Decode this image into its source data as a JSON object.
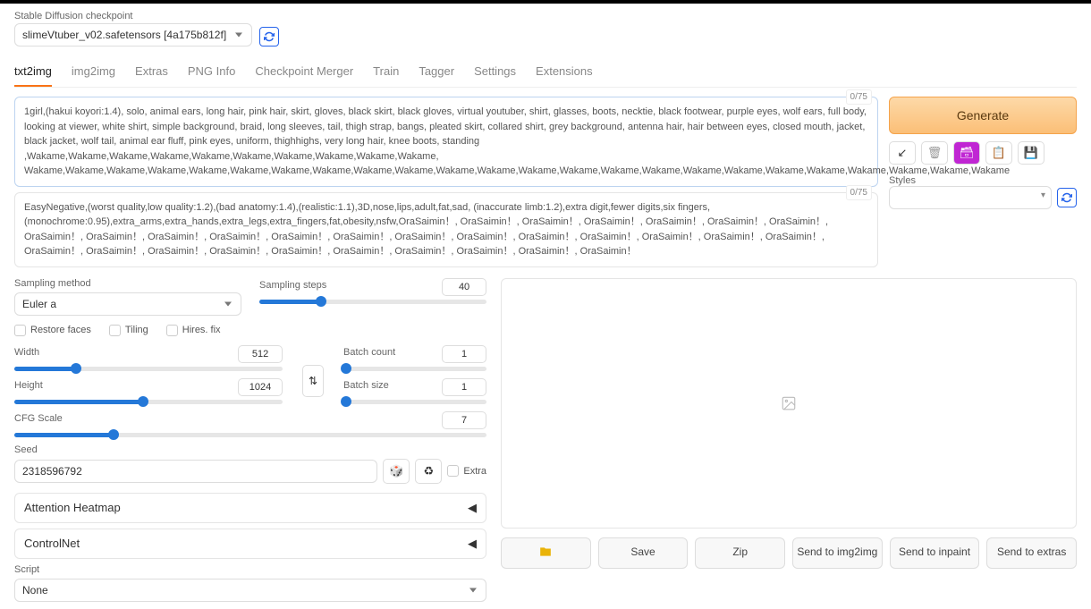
{
  "checkpoint": {
    "label": "Stable Diffusion checkpoint",
    "value": "slimeVtuber_v02.safetensors [4a175b812f]"
  },
  "tabs": [
    "txt2img",
    "img2img",
    "Extras",
    "PNG Info",
    "Checkpoint Merger",
    "Train",
    "Tagger",
    "Settings",
    "Extensions"
  ],
  "active_tab": 0,
  "prompt": {
    "counter": "0/75",
    "text": "1girl,(hakui koyori:1.4), solo, animal ears, long hair, pink hair, skirt, gloves, black skirt, black gloves, virtual youtuber, shirt, glasses, boots, necktie, black footwear, purple eyes, wolf ears, full body, looking at viewer, white shirt, simple background, braid, long sleeves, tail, thigh strap, bangs, pleated skirt, collared shirt, grey background, antenna hair, hair between eyes, closed mouth, jacket, black jacket, wolf tail, animal ear fluff, pink eyes, uniform, thighhighs, very long hair, knee boots, standing ,Wakame,Wakame,Wakame,Wakame,Wakame,Wakame,Wakame,Wakame,Wakame,Wakame, Wakame,Wakame,Wakame,Wakame,Wakame,Wakame,Wakame,Wakame,Wakame,Wakame,Wakame,Wakame,Wakame,Wakame,Wakame,Wakame,Wakame,Wakame,Wakame,Wakame,Wakame,Wakame,Wakame,Wakame"
  },
  "neg_prompt": {
    "counter": "0/75",
    "text": "EasyNegative,(worst quality,low quality:1.2),(bad anatomy:1.4),(realistic:1.1),3D,nose,lips,adult,fat,sad, (inaccurate limb:1.2),extra digit,fewer digits,six fingers,(monochrome:0.95),extra_arms,extra_hands,extra_legs,extra_fingers,fat,obesity,nsfw,OraSaimin！, OraSaimin！, OraSaimin！, OraSaimin！, OraSaimin！, OraSaimin！, OraSaimin！, OraSaimin！, OraSaimin！, OraSaimin！, OraSaimin！, OraSaimin！, OraSaimin！, OraSaimin！, OraSaimin！, OraSaimin！, OraSaimin！, OraSaimin！, OraSaimin！, OraSaimin！, OraSaimin！, OraSaimin！, OraSaimin！, OraSaimin！, OraSaimin！, OraSaimin！, OraSaimin！, OraSaimin！, OraSaimin！, OraSaimin！"
  },
  "generate_label": "Generate",
  "styles_label": "Styles",
  "sampling": {
    "method_label": "Sampling method",
    "method_value": "Euler a",
    "steps_label": "Sampling steps",
    "steps_value": "40"
  },
  "checks": {
    "restore": "Restore faces",
    "tiling": "Tiling",
    "hires": "Hires. fix"
  },
  "dims": {
    "width_label": "Width",
    "width_value": "512",
    "height_label": "Height",
    "height_value": "1024",
    "batch_count_label": "Batch count",
    "batch_count_value": "1",
    "batch_size_label": "Batch size",
    "batch_size_value": "1"
  },
  "cfg": {
    "label": "CFG Scale",
    "value": "7"
  },
  "seed": {
    "label": "Seed",
    "value": "2318596792",
    "extra_label": "Extra"
  },
  "accordions": {
    "heatmap": "Attention Heatmap",
    "controlnet": "ControlNet"
  },
  "script": {
    "label": "Script",
    "value": "None"
  },
  "actions": {
    "save": "Save",
    "zip": "Zip",
    "img2img": "Send to img2img",
    "inpaint": "Send to inpaint",
    "extras": "Send to extras"
  }
}
